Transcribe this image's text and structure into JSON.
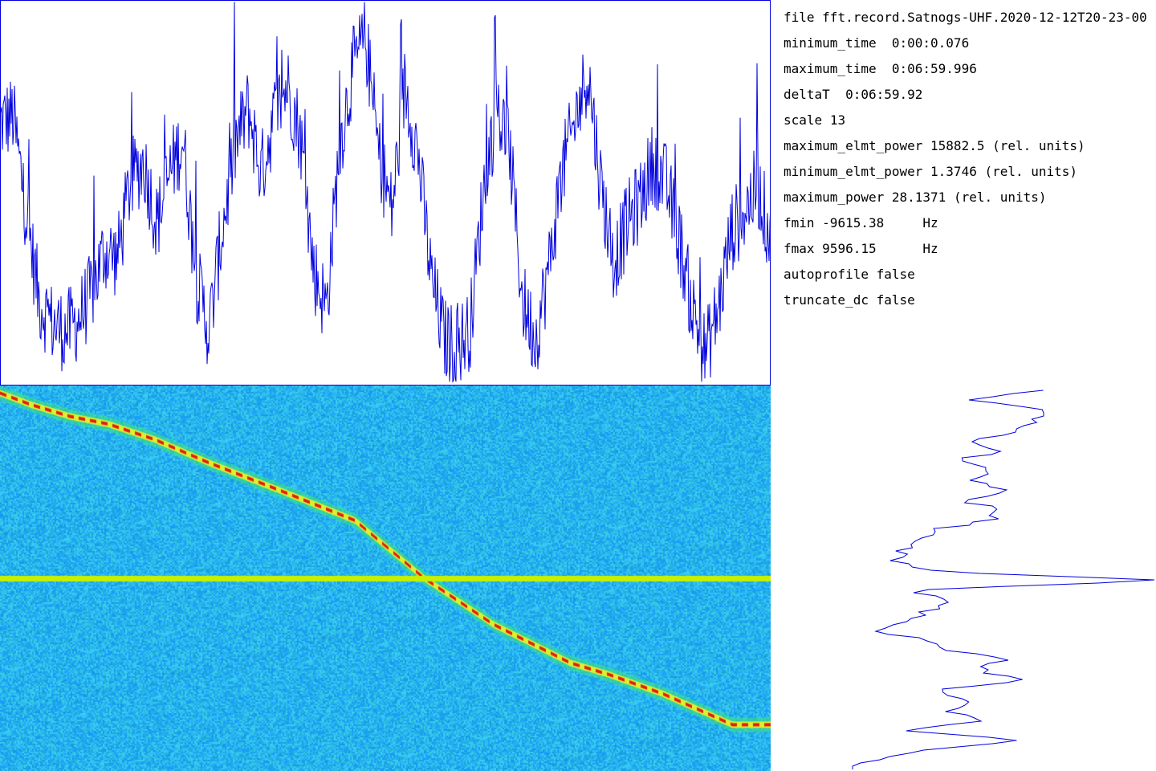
{
  "info": [
    {
      "key": "file",
      "value": "fft.record.Satnogs-UHF.2020-12-12T20-23-00"
    },
    {
      "key": "minimum_time",
      "value": " 0:00:0.076"
    },
    {
      "key": "maximum_time",
      "value": " 0:06:59.996"
    },
    {
      "key": "deltaT",
      "value": " 0:06:59.92"
    },
    {
      "key": "scale",
      "value": "13"
    },
    {
      "key": "maximum_elmt_power",
      "value": "15882.5 (rel. units)"
    },
    {
      "key": "minimum_elmt_power",
      "value": "1.3746 (rel. units)"
    },
    {
      "key": "maximum_power",
      "value": "28.1371 (rel. units)"
    },
    {
      "key": "fmin",
      "value": "-9615.38     Hz"
    },
    {
      "key": "fmax",
      "value": "9596.15      Hz"
    },
    {
      "key": "autoprofile",
      "value": "false"
    },
    {
      "key": "truncate_dc",
      "value": "false"
    }
  ],
  "colors": {
    "trace": "#0000dd",
    "dc_line": "#c8f000",
    "signal_peak": "#e02010",
    "background_noise": "#1fb0f0"
  },
  "chart_data": [
    {
      "type": "line",
      "name_hint": "power-vs-time",
      "x_range": [
        0,
        1
      ],
      "y_range": [
        0,
        1
      ],
      "grid": false,
      "envelope": [
        0.68,
        0.7,
        0.45,
        0.22,
        0.16,
        0.14,
        0.17,
        0.24,
        0.35,
        0.33,
        0.53,
        0.58,
        0.42,
        0.55,
        0.64,
        0.28,
        0.14,
        0.4,
        0.62,
        0.72,
        0.55,
        0.7,
        0.78,
        0.65,
        0.3,
        0.2,
        0.62,
        0.82,
        0.9,
        0.6,
        0.45,
        0.78,
        0.6,
        0.28,
        0.12,
        0.1,
        0.15,
        0.5,
        0.72,
        0.62,
        0.22,
        0.12,
        0.3,
        0.55,
        0.68,
        0.82,
        0.52,
        0.32,
        0.42,
        0.48,
        0.58,
        0.52,
        0.38,
        0.2,
        0.08,
        0.2,
        0.4,
        0.45,
        0.52,
        0.38
      ]
    },
    {
      "type": "heatmap",
      "name_hint": "spectrogram",
      "doppler_track": [
        0.0,
        0.04,
        0.09,
        0.14,
        0.2,
        0.27,
        0.36,
        0.46,
        0.55,
        0.64,
        0.69,
        0.74,
        0.79,
        0.86,
        0.95
      ],
      "doppler_freq": [
        0.02,
        0.05,
        0.08,
        0.1,
        0.14,
        0.2,
        0.27,
        0.35,
        0.5,
        0.62,
        0.67,
        0.72,
        0.75,
        0.8,
        0.88
      ],
      "dc_row": 0.5
    },
    {
      "type": "line",
      "name_hint": "power-profile",
      "profile": [
        0.65,
        0.43,
        0.64,
        0.62,
        0.57,
        0.42,
        0.53,
        0.38,
        0.5,
        0.45,
        0.55,
        0.4,
        0.52,
        0.48,
        0.3,
        0.26,
        0.22,
        0.18,
        0.28,
        1.0,
        0.2,
        0.4,
        0.3,
        0.22,
        0.15,
        0.28,
        0.38,
        0.53,
        0.45,
        0.58,
        0.3,
        0.42,
        0.36,
        0.45,
        0.22,
        0.6,
        0.25,
        0.13,
        0.02
      ]
    }
  ]
}
